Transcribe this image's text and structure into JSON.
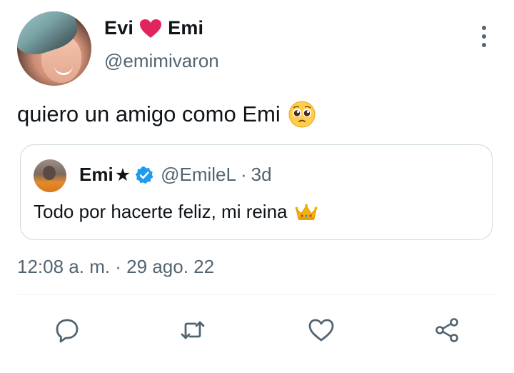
{
  "author": {
    "display_name_left": "Evi",
    "display_name_right": "Emi",
    "username": "@emimivaron"
  },
  "tweet": {
    "text": "quiero un amigo como Emi",
    "emoji_icon": "pleading-face-icon",
    "timestamp": "12:08 a. m. · 29 ago. 22"
  },
  "quoted_tweet": {
    "name": "Emi",
    "name_symbol": "★",
    "handle": "@EmileL",
    "separator": "·",
    "time": "3d",
    "text": "Todo por hacerte feliz, mi reina",
    "emoji_icon": "crown-icon"
  },
  "actions": [
    "reply-icon",
    "retweet-icon",
    "like-icon",
    "share-icon"
  ],
  "colors": {
    "text": "#0f1419",
    "secondary": "#536471",
    "border": "#cfd9de",
    "heart": "#e0245e",
    "verified": "#1d9bf0"
  }
}
